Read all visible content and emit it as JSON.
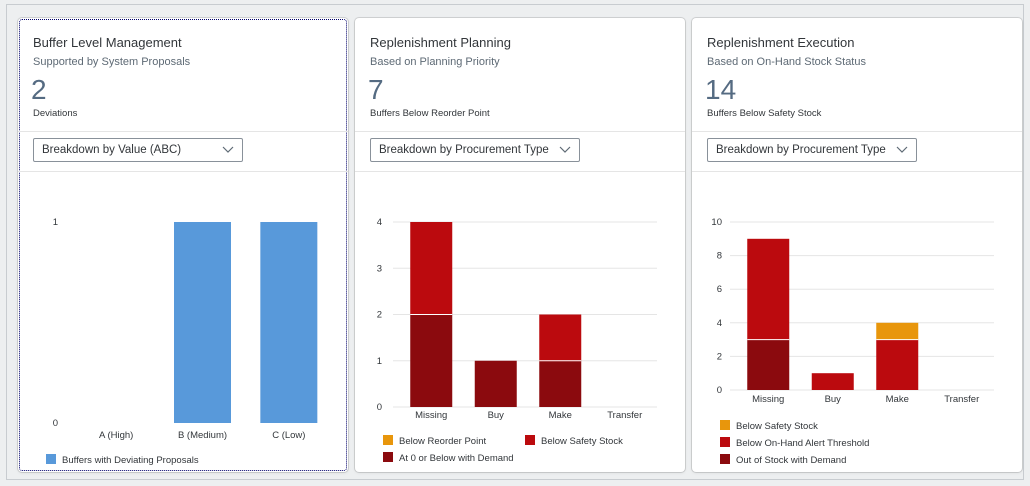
{
  "cards": [
    {
      "title": "Buffer Level Management",
      "subtitle": "Supported by System Proposals",
      "kpi_value": "2",
      "kpi_label": "Deviations",
      "select_value": "Breakdown by Value (ABC)",
      "legend": [
        {
          "label": "Buffers with Deviating Proposals",
          "color": "#5899da"
        }
      ]
    },
    {
      "title": "Replenishment Planning",
      "subtitle": "Based on Planning Priority",
      "kpi_value": "7",
      "kpi_label": "Buffers Below Reorder Point",
      "select_value": "Breakdown by Procurement Type",
      "legend": [
        {
          "label": "Below Reorder Point",
          "color": "#e8960c"
        },
        {
          "label": "Below Safety Stock",
          "color": "#bb0a0e"
        },
        {
          "label": "At 0 or Below with Demand",
          "color": "#8b0a0e"
        }
      ]
    },
    {
      "title": "Replenishment Execution",
      "subtitle": "Based on On-Hand Stock Status",
      "kpi_value": "14",
      "kpi_label": "Buffers Below Safety Stock",
      "select_value": "Breakdown by Procurement Type",
      "legend": [
        {
          "label": "Below Safety Stock",
          "color": "#e8960c"
        },
        {
          "label": "Below On-Hand Alert Threshold",
          "color": "#bb0a0e"
        },
        {
          "label": "Out of Stock with Demand",
          "color": "#8b0a0e"
        }
      ]
    }
  ],
  "chart_data": [
    {
      "type": "bar",
      "categories": [
        "A (High)",
        "B (Medium)",
        "C (Low)"
      ],
      "series": [
        {
          "name": "Buffers with Deviating Proposals",
          "values": [
            0,
            1,
            1
          ],
          "color": "#5899da"
        }
      ],
      "yticks": [
        0,
        1
      ],
      "ylim": [
        0,
        1
      ],
      "grid": false
    },
    {
      "type": "bar",
      "stacked": true,
      "categories": [
        "Missing",
        "Buy",
        "Make",
        "Transfer"
      ],
      "series": [
        {
          "name": "At 0 or Below with Demand",
          "values": [
            2,
            1,
            1,
            0
          ],
          "color": "#8b0a0e"
        },
        {
          "name": "Below Safety Stock",
          "values": [
            2,
            0,
            1,
            0
          ],
          "color": "#bb0a0e"
        },
        {
          "name": "Below Reorder Point",
          "values": [
            0,
            0,
            0,
            0
          ],
          "color": "#e8960c"
        }
      ],
      "yticks": [
        0,
        1,
        2,
        3,
        4
      ],
      "ylim": [
        0,
        4
      ],
      "grid": true
    },
    {
      "type": "bar",
      "stacked": true,
      "categories": [
        "Missing",
        "Buy",
        "Make",
        "Transfer"
      ],
      "series": [
        {
          "name": "Out of Stock with Demand",
          "values": [
            3,
            0,
            0,
            0
          ],
          "color": "#8b0a0e"
        },
        {
          "name": "Below On-Hand Alert Threshold",
          "values": [
            6,
            1,
            3,
            0
          ],
          "color": "#bb0a0e"
        },
        {
          "name": "Below Safety Stock",
          "values": [
            0,
            0,
            1,
            0
          ],
          "color": "#e8960c"
        }
      ],
      "yticks": [
        0,
        2,
        4,
        6,
        8,
        10
      ],
      "ylim": [
        0,
        10
      ],
      "grid": true
    }
  ]
}
